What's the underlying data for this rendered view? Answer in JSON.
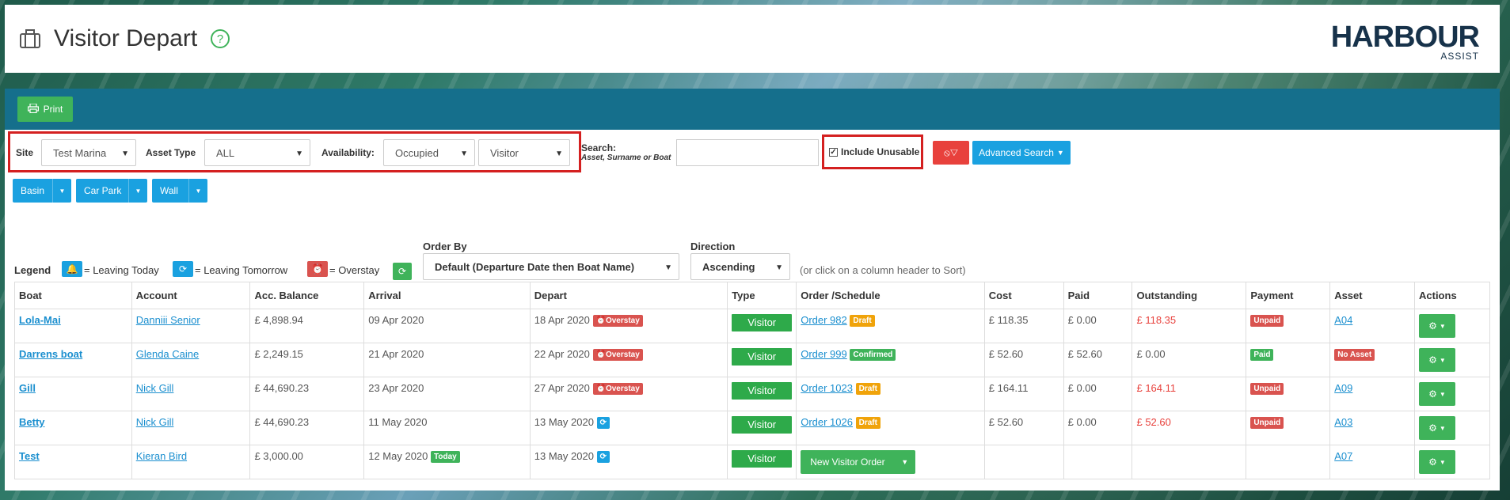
{
  "header": {
    "title": "Visitor Depart",
    "logo_main": "HARBOUR",
    "logo_sub": "ASSIST"
  },
  "toolbar": {
    "print_label": "Print"
  },
  "filters": {
    "site_label": "Site",
    "site_value": "Test Marina",
    "asset_type_label": "Asset Type",
    "asset_type_value": "ALL",
    "availability_label": "Availability:",
    "availability_value": "Occupied",
    "visitor_value": "Visitor",
    "search_label": "Search:",
    "search_sub": "Asset, Surname or Boat",
    "search_value": "",
    "include_unusable_label": "Include Unusable",
    "include_unusable_checked": true,
    "advanced_search_label": "Advanced Search"
  },
  "asset_groups": [
    "Basin",
    "Car Park",
    "Wall"
  ],
  "legend": {
    "title": "Legend",
    "leaving_today": "= Leaving Today",
    "leaving_tomorrow": "= Leaving Tomorrow",
    "overstay": "= Overstay"
  },
  "order_by": {
    "label": "Order By",
    "value": "Default (Departure Date then Boat Name)"
  },
  "direction": {
    "label": "Direction",
    "value": "Ascending"
  },
  "sort_hint": "(or click on a column header to Sort)",
  "table": {
    "headers": [
      "Boat",
      "Account",
      "Acc. Balance",
      "Arrival",
      "Depart",
      "Type",
      "Order /Schedule",
      "Cost",
      "Paid",
      "Outstanding",
      "Payment",
      "Asset",
      "Actions"
    ],
    "rows": [
      {
        "boat": "Lola-Mai",
        "account": "Danniii Senior",
        "balance": "£ 4,898.94",
        "arrival": "09 Apr 2020",
        "arrival_badge": "",
        "depart": "18 Apr 2020",
        "depart_badge": "Overstay",
        "type": "Visitor",
        "order": "Order 982",
        "order_status": "Draft",
        "cost": "£ 118.35",
        "paid": "£ 0.00",
        "outstanding": "£ 118.35",
        "payment": "Unpaid",
        "asset": "A04"
      },
      {
        "boat": "Darrens boat",
        "account": "Glenda Caine",
        "balance": "£ 2,249.15",
        "arrival": "21 Apr 2020",
        "arrival_badge": "",
        "depart": "22 Apr 2020",
        "depart_badge": "Overstay",
        "type": "Visitor",
        "order": "Order 999",
        "order_status": "Confirmed",
        "cost": "£ 52.60",
        "paid": "£ 52.60",
        "outstanding": "£ 0.00",
        "payment": "Paid",
        "asset": "No Asset"
      },
      {
        "boat": "Gill",
        "account": "Nick Gill",
        "balance": "£ 44,690.23",
        "arrival": "23 Apr 2020",
        "arrival_badge": "",
        "depart": "27 Apr 2020",
        "depart_badge": "Overstay",
        "type": "Visitor",
        "order": "Order 1023",
        "order_status": "Draft",
        "cost": "£ 164.11",
        "paid": "£ 0.00",
        "outstanding": "£ 164.11",
        "payment": "Unpaid",
        "asset": "A09"
      },
      {
        "boat": "Betty",
        "account": "Nick Gill",
        "balance": "£ 44,690.23",
        "arrival": "11 May 2020",
        "arrival_badge": "",
        "depart": "13 May 2020",
        "depart_badge": "",
        "type": "Visitor",
        "order": "Order 1026",
        "order_status": "Draft",
        "cost": "£ 52.60",
        "paid": "£ 0.00",
        "outstanding": "£ 52.60",
        "payment": "Unpaid",
        "asset": "A03"
      },
      {
        "boat": "Test",
        "account": "Kieran Bird",
        "balance": "£ 3,000.00",
        "arrival": "12 May 2020",
        "arrival_badge": "Today",
        "depart": "13 May 2020",
        "depart_badge": "",
        "type": "Visitor",
        "order": "",
        "order_status": "",
        "new_order_label": "New Visitor Order",
        "cost": "",
        "paid": "",
        "outstanding": "",
        "payment": "",
        "asset": "A07"
      }
    ]
  }
}
